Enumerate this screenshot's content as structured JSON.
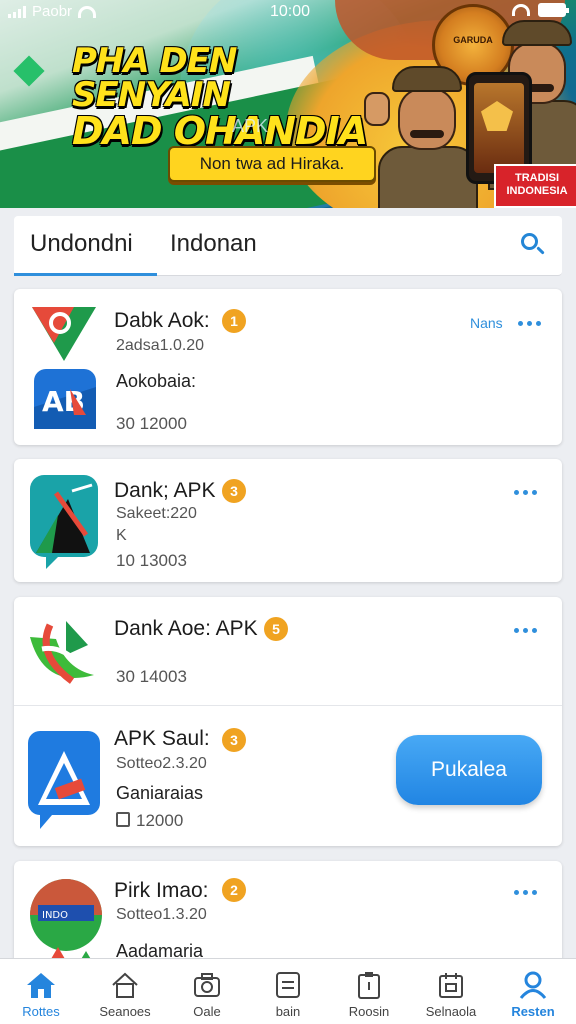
{
  "status_bar": {
    "carrier": "Paobr",
    "time": "10:00"
  },
  "banner": {
    "headline_line1": "PHA DEN SENYAIN",
    "headline_line2": "DAD OHANDIA",
    "watermark": "APK",
    "cta_label": "Non twa ad Hiraka.",
    "emblem_text": "GARUDA",
    "tag_text": "TRADISI INDONESIA"
  },
  "tabs": {
    "items": [
      {
        "label": "Undondni"
      },
      {
        "label": "Indonan"
      }
    ],
    "active_index": 0
  },
  "apps": [
    {
      "title": "Dabk Aok:",
      "badge": "1",
      "subtitle": "2adsa1.0.20",
      "more_label": "Nans",
      "secondary_title": "Aokobaia:",
      "count": "30 12000"
    },
    {
      "title": "Dank; APK",
      "badge": "3",
      "subtitle": "Sakeet:220",
      "extra": "K",
      "count": "10 13003"
    },
    {
      "title": "Dank Aoe: APK",
      "badge": "5",
      "count": "30 14003"
    },
    {
      "title": "APK Saul:",
      "badge": "3",
      "subtitle": "Sotteo2.3.20",
      "description": "Ganiaraias",
      "count": "12000",
      "button_label": "Pukalea"
    },
    {
      "title": "Pirk Imao:",
      "badge": "2",
      "subtitle": "Sotteo1.3.20",
      "description": "Aadamaria"
    }
  ],
  "bottom_nav": {
    "items": [
      {
        "label": "Rottes",
        "icon": "home-icon"
      },
      {
        "label": "Seanoes",
        "icon": "house-outline-icon"
      },
      {
        "label": "Oale",
        "icon": "camera-icon"
      },
      {
        "label": "bain",
        "icon": "list-icon"
      },
      {
        "label": "Roosin",
        "icon": "clipboard-icon"
      },
      {
        "label": "Selnaola",
        "icon": "calendar-icon"
      },
      {
        "label": "Resten",
        "icon": "profile-icon"
      }
    ],
    "active_index": 6
  },
  "colors": {
    "accent": "#2486d6",
    "badge": "#f0a321",
    "banner_cta": "#ffd41f"
  }
}
